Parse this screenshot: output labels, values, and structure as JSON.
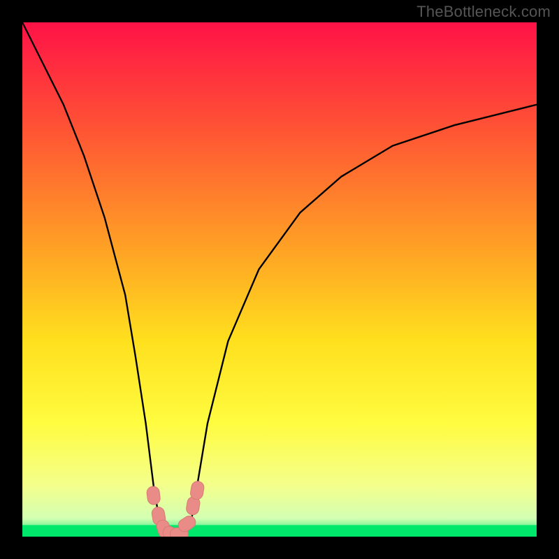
{
  "watermark": "TheBottleneck.com",
  "chart_data": {
    "type": "line",
    "title": "",
    "xlabel": "",
    "ylabel": "",
    "xlim": [
      0,
      100
    ],
    "ylim": [
      0,
      100
    ],
    "curve": [
      {
        "x": 0,
        "y": 100
      },
      {
        "x": 4,
        "y": 92
      },
      {
        "x": 8,
        "y": 84
      },
      {
        "x": 12,
        "y": 74
      },
      {
        "x": 16,
        "y": 62
      },
      {
        "x": 20,
        "y": 47
      },
      {
        "x": 22,
        "y": 35
      },
      {
        "x": 24,
        "y": 22
      },
      {
        "x": 25.5,
        "y": 10
      },
      {
        "x": 26.5,
        "y": 4
      },
      {
        "x": 27.5,
        "y": 1
      },
      {
        "x": 29,
        "y": 0
      },
      {
        "x": 30.5,
        "y": 0
      },
      {
        "x": 32,
        "y": 1
      },
      {
        "x": 33,
        "y": 4
      },
      {
        "x": 34,
        "y": 10
      },
      {
        "x": 36,
        "y": 22
      },
      {
        "x": 40,
        "y": 38
      },
      {
        "x": 46,
        "y": 52
      },
      {
        "x": 54,
        "y": 63
      },
      {
        "x": 62,
        "y": 70
      },
      {
        "x": 72,
        "y": 76
      },
      {
        "x": 84,
        "y": 80
      },
      {
        "x": 100,
        "y": 84
      }
    ],
    "markers": [
      {
        "x": 25.5,
        "y": 8
      },
      {
        "x": 26.5,
        "y": 4
      },
      {
        "x": 27.5,
        "y": 1.5
      },
      {
        "x": 29.0,
        "y": 0.5
      },
      {
        "x": 30.5,
        "y": 0.5
      },
      {
        "x": 32.0,
        "y": 2.5
      },
      {
        "x": 33.2,
        "y": 6
      },
      {
        "x": 34.0,
        "y": 9
      }
    ],
    "green_band": {
      "y0": 0,
      "y1": 5
    },
    "background_gradient": {
      "stops": [
        {
          "offset": 0.0,
          "color": "#ff1247"
        },
        {
          "offset": 0.2,
          "color": "#ff5135"
        },
        {
          "offset": 0.45,
          "color": "#ffa524"
        },
        {
          "offset": 0.62,
          "color": "#ffe01e"
        },
        {
          "offset": 0.78,
          "color": "#fffc40"
        },
        {
          "offset": 0.9,
          "color": "#f4ff8c"
        },
        {
          "offset": 0.965,
          "color": "#d3ffb3"
        },
        {
          "offset": 1.0,
          "color": "#00e86c"
        }
      ]
    },
    "colors": {
      "curve": "#000000",
      "marker_fill": "#e98b86",
      "marker_stroke": "#d87a75",
      "green_bottom": "#00e86c"
    }
  }
}
